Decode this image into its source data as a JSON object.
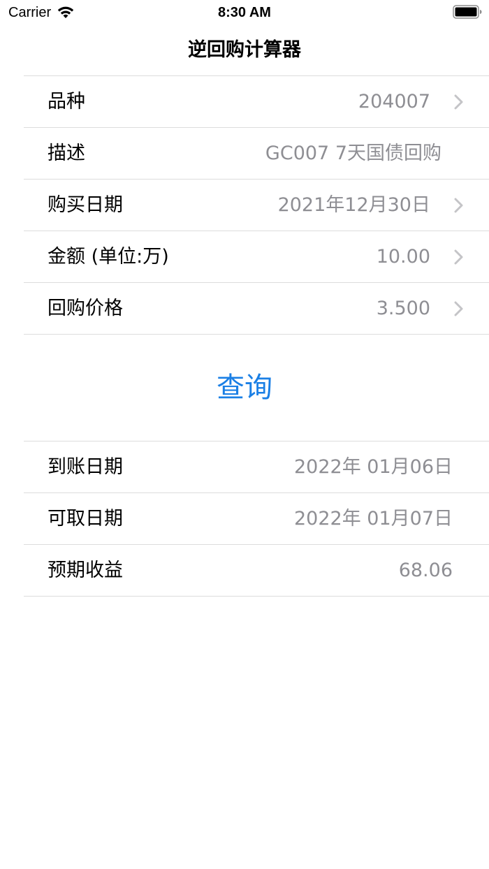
{
  "status_bar": {
    "carrier": "Carrier",
    "time": "8:30 AM"
  },
  "nav": {
    "title": "逆回购计算器"
  },
  "form": {
    "rows": [
      {
        "label": "品种",
        "value": "204007",
        "chevron": true
      },
      {
        "label": "描述",
        "value": "GC007  7天国债回购",
        "chevron": false
      },
      {
        "label": "购买日期",
        "value": "2021年12月30日",
        "chevron": true
      },
      {
        "label": "金额 (单位:万)",
        "value": "10.00",
        "chevron": true
      },
      {
        "label": "回购价格",
        "value": "3.500",
        "chevron": true
      }
    ]
  },
  "query_button": {
    "label": "查询"
  },
  "results": {
    "rows": [
      {
        "label": "到账日期",
        "value": "2022年 01月06日"
      },
      {
        "label": "可取日期",
        "value": "2022年 01月07日"
      },
      {
        "label": "预期收益",
        "value": "68.06"
      }
    ]
  },
  "colors": {
    "accent": "#1a7fe5",
    "secondary_text": "#8e8e93",
    "separator": "#dcdcdc",
    "chevron": "#c4c4c7"
  },
  "icons": [
    "wifi-icon",
    "battery-icon",
    "chevron-right-icon"
  ]
}
